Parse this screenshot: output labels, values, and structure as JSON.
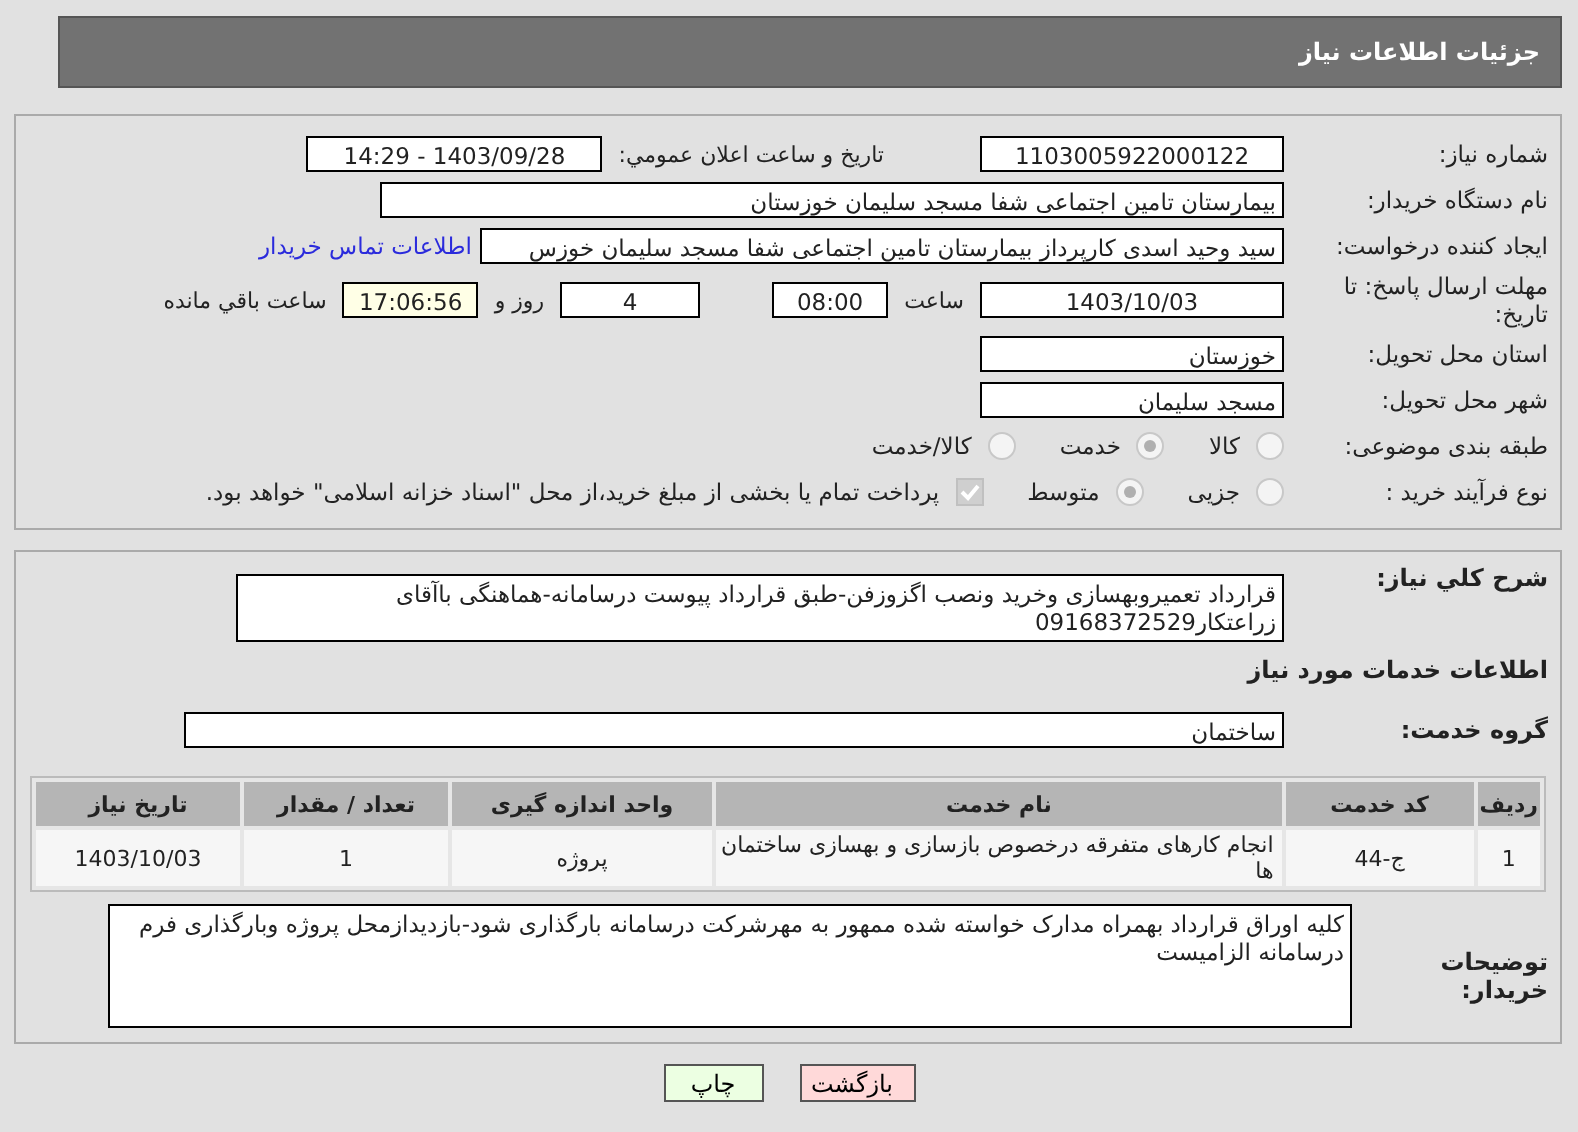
{
  "header": {
    "title": "جزئیات اطلاعات نیاز"
  },
  "info": {
    "need_number": {
      "label": "شماره نیاز:",
      "value": "1103005922000122"
    },
    "announce": {
      "label": "تاریخ و ساعت اعلان عمومي:",
      "value": "1403/09/28 - 14:29"
    },
    "buyer": {
      "label": "نام دستگاه خریدار:",
      "value": "بیمارستان تامین اجتماعی شفا مسجد سلیمان خوزستان"
    },
    "creator": {
      "label": "ایجاد کننده درخواست:",
      "value": "سید وحید اسدی کارپرداز بیمارستان تامین اجتماعی شفا مسجد سلیمان خوزس",
      "link": "اطلاعات تماس خریدار"
    },
    "deadline": {
      "label": "مهلت ارسال پاسخ: تا تاریخ:",
      "date": "1403/10/03",
      "time_label": "ساعت",
      "time": "08:00",
      "days": "4",
      "days_label": "روز و",
      "remaining": "17:06:56",
      "remaining_label": "ساعت باقي مانده"
    },
    "province": {
      "label": "استان محل تحویل:",
      "value": "خوزستان"
    },
    "city": {
      "label": "شهر محل تحویل:",
      "value": "مسجد سلیمان"
    },
    "category": {
      "label": "طبقه بندی موضوعی:",
      "options": [
        {
          "label": "کالا",
          "selected": false
        },
        {
          "label": "خدمت",
          "selected": true
        },
        {
          "label": "کالا/خدمت",
          "selected": false
        }
      ]
    },
    "process": {
      "label": "نوع فرآیند خرید :",
      "options": [
        {
          "label": "جزیی",
          "selected": false
        },
        {
          "label": "متوسط",
          "selected": true
        }
      ],
      "payment": {
        "checked": true,
        "label": "پرداخت تمام یا بخشی از مبلغ خرید،از محل \"اسناد خزانه اسلامی\" خواهد بود."
      }
    }
  },
  "details": {
    "summary": {
      "label": "شرح کلي نیاز:",
      "value": "قرارداد تعمیروبهسازی وخرید ونصب اگزوزفن-طبق قرارداد پیوست درسامانه-هماهنگی باآقای زراعتکار09168372529"
    },
    "services_title": "اطلاعات خدمات مورد نیاز",
    "group": {
      "label": "گروه خدمت:",
      "value": "ساختمان"
    },
    "table": {
      "columns": [
        "ردیف",
        "کد خدمت",
        "نام خدمت",
        "واحد اندازه گیری",
        "تعداد / مقدار",
        "تاریخ نیاز"
      ],
      "rows": [
        [
          "1",
          "ج-44",
          "انجام کارهای متفرقه درخصوص بازسازی و بهسازی ساختمان ها",
          "پروژه",
          "1",
          "1403/10/03"
        ]
      ]
    },
    "notes": {
      "label": "توضیحات خریدار:",
      "value": "کلیه اوراق قرارداد بهمراه مدارک خواسته شده ممهور به مهرشرکت درسامانه بارگذاری شود-بازدیدازمحل پروژه وبارگذاری فرم درسامانه الزامیست"
    }
  },
  "buttons": [
    {
      "label": "بازگشت",
      "kind": "back"
    },
    {
      "label": "چاپ",
      "kind": "print"
    }
  ]
}
